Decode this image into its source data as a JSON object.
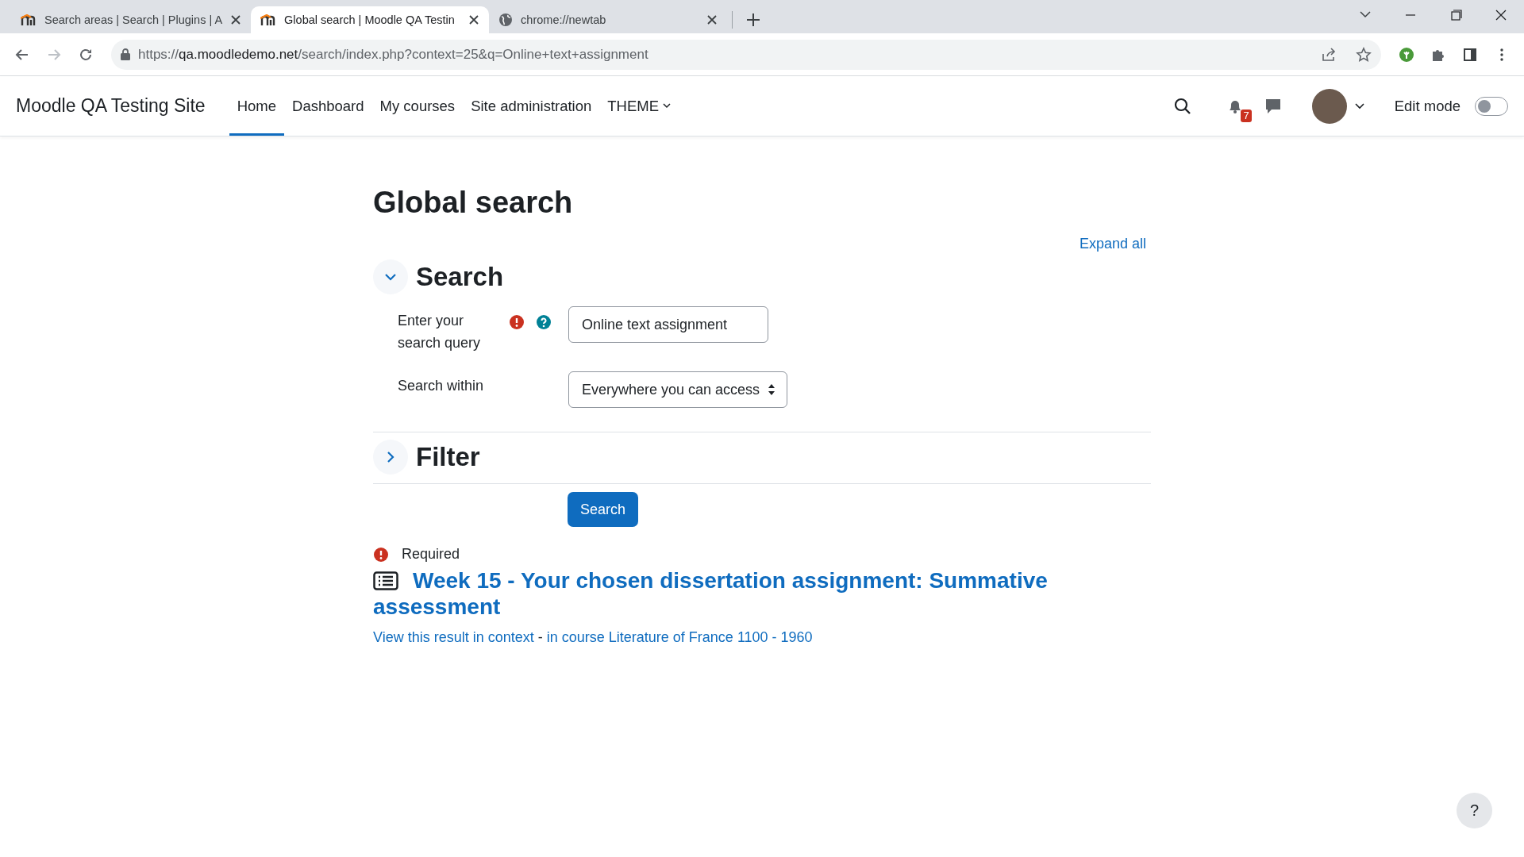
{
  "browser": {
    "tabs": [
      {
        "title": "Search areas | Search | Plugins | A",
        "kind": "moodle",
        "selected": false
      },
      {
        "title": "Global search | Moodle QA Testin",
        "kind": "moodle",
        "selected": true
      },
      {
        "title": "chrome://newtab",
        "kind": "globe",
        "selected": false
      }
    ],
    "url": {
      "scheme": "https://",
      "host": "qa.moodledemo.net",
      "path": "/search/index.php?context=25&q=Online+text+assignment"
    }
  },
  "navbar": {
    "site_name": "Moodle QA Testing Site",
    "items": [
      {
        "label": "Home",
        "selected": true,
        "dropdown": false
      },
      {
        "label": "Dashboard",
        "selected": false,
        "dropdown": false
      },
      {
        "label": "My courses",
        "selected": false,
        "dropdown": false
      },
      {
        "label": "Site administration",
        "selected": false,
        "dropdown": false
      },
      {
        "label": "THEME",
        "selected": false,
        "dropdown": true
      }
    ],
    "notification_count": "7",
    "edit_mode": {
      "label": "Edit mode",
      "on": false
    }
  },
  "page": {
    "title": "Global search",
    "expand_all": "Expand all",
    "sections": [
      {
        "title": "Search",
        "expanded": true,
        "fields": [
          {
            "kind": "text",
            "label": "Enter your search query",
            "required": true,
            "help": true,
            "value": "Online text assignment"
          },
          {
            "kind": "select",
            "label": "Search within",
            "required": false,
            "help": false,
            "value": "Everywhere you can access"
          }
        ]
      },
      {
        "title": "Filter",
        "expanded": false
      }
    ],
    "search_button": "Search",
    "required_note": "Required",
    "result": {
      "title": "Week 15 - Your chosen dissertation assignment: Summative assessment",
      "context_link": "View this result in context",
      "separator": " - ",
      "course_link": "in course Literature of France 1100 - 1960"
    },
    "help_button": "?"
  }
}
